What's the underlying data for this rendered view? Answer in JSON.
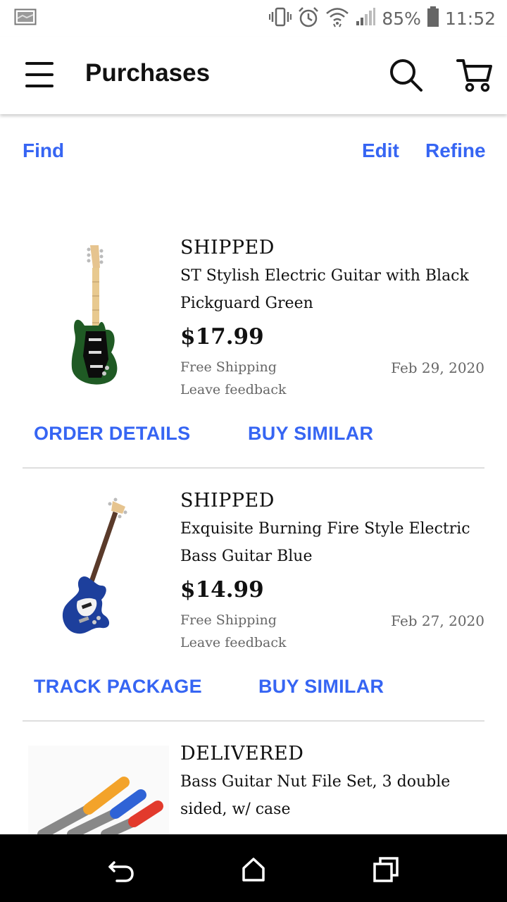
{
  "status_bar": {
    "battery": "85%",
    "time": "11:52"
  },
  "app_bar": {
    "title": "Purchases"
  },
  "actions": {
    "find": "Find",
    "edit": "Edit",
    "refine": "Refine"
  },
  "purchases": [
    {
      "status": "SHIPPED",
      "title": "ST Stylish Electric Guitar with Black Pickguard Green",
      "price": "$17.99",
      "shipping": "Free Shipping",
      "date": "Feb 29, 2020",
      "feedback": "Leave feedback",
      "primary_action": "ORDER DETAILS",
      "secondary_action": "BUY SIMILAR"
    },
    {
      "status": "SHIPPED",
      "title": "Exquisite Burning Fire Style Electric Bass Guitar Blue",
      "price": "$14.99",
      "shipping": "Free Shipping",
      "date": "Feb 27, 2020",
      "feedback": "Leave feedback",
      "primary_action": "TRACK PACKAGE",
      "secondary_action": "BUY SIMILAR"
    },
    {
      "status": "DELIVERED",
      "title": "Bass Guitar Nut File Set, 3 double sided, w/ case"
    }
  ],
  "colors": {
    "link": "#3665f3",
    "text": "#111111",
    "muted": "#666666",
    "nav_bar": "#000000"
  }
}
